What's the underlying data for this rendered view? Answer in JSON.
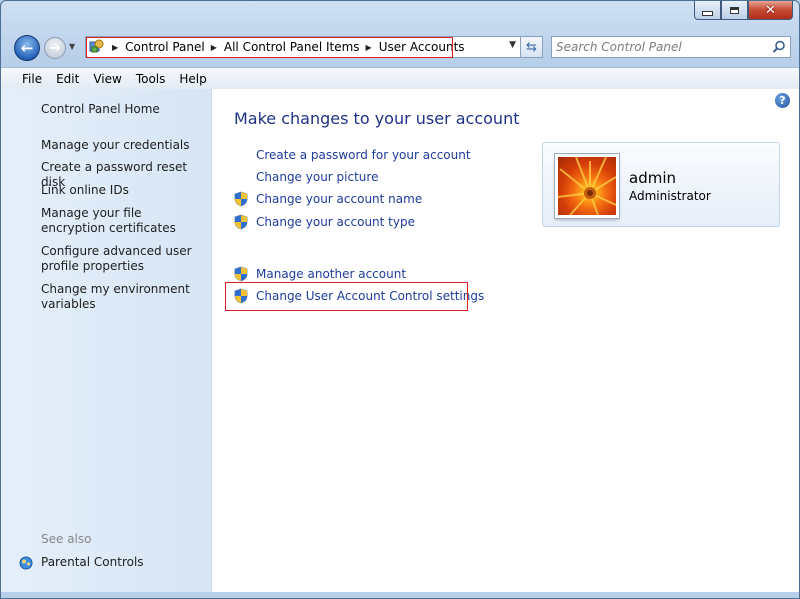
{
  "window": {
    "caption": {
      "minimize": "minimize",
      "maximize": "maximize",
      "close": "close"
    }
  },
  "nav": {
    "breadcrumbs": [
      "Control Panel",
      "All Control Panel Items",
      "User Accounts"
    ],
    "search_placeholder": "Search Control Panel"
  },
  "menu": [
    "File",
    "Edit",
    "View",
    "Tools",
    "Help"
  ],
  "sidebar": {
    "home": "Control Panel Home",
    "links": [
      "Manage your credentials",
      "Create a password reset disk",
      "Link online IDs",
      "Manage your file encryption certificates",
      "Configure advanced user profile properties",
      "Change my environment variables"
    ],
    "see_also_label": "See also",
    "see_also_links": [
      "Parental Controls"
    ]
  },
  "main": {
    "heading": "Make changes to your user account",
    "tasks": [
      {
        "label": "Create a password for your account",
        "shield": false
      },
      {
        "label": "Change your picture",
        "shield": false
      },
      {
        "label": "Change your account name",
        "shield": true
      },
      {
        "label": "Change your account type",
        "shield": true
      },
      {
        "label": "Manage another account",
        "shield": true
      },
      {
        "label": "Change User Account Control settings",
        "shield": true
      }
    ],
    "account": {
      "name": "admin",
      "type": "Administrator"
    }
  },
  "colors": {
    "link": "#1e3c9c",
    "heading": "#1e3287",
    "highlight": "#e02020",
    "sidebar_bg": "#dce8f6"
  }
}
